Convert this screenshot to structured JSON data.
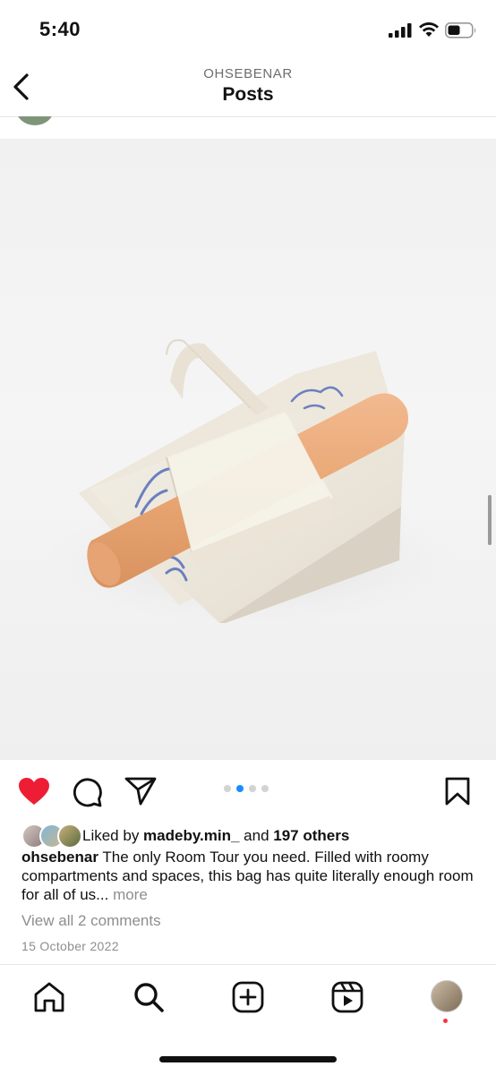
{
  "status": {
    "time": "5:40"
  },
  "header": {
    "username": "OHSEBENAR",
    "title": "Posts"
  },
  "post": {
    "carousel": {
      "total": 4,
      "active_index": 1
    },
    "likes": {
      "prefix": "Liked by ",
      "user": "madeby.min_",
      "middle": " and ",
      "others": "197 others"
    },
    "caption": {
      "username": "ohsebenar",
      "text": " The only Room Tour you need. Filled with roomy compartments and spaces, this bag has quite literally enough room for all of us...",
      "more": "more"
    },
    "comments_link": "View all 2 comments",
    "date": "15 October 2022"
  },
  "icons": {
    "like": "heart-filled-icon",
    "comment": "comment-icon",
    "share": "share-icon",
    "save": "bookmark-icon",
    "tabs": [
      "home-icon",
      "search-icon",
      "create-icon",
      "reels-icon",
      "profile-avatar"
    ]
  },
  "colors": {
    "like": "#ee1d36",
    "carousel_active": "#1a8cff",
    "notification_dot": "#ff3040"
  }
}
